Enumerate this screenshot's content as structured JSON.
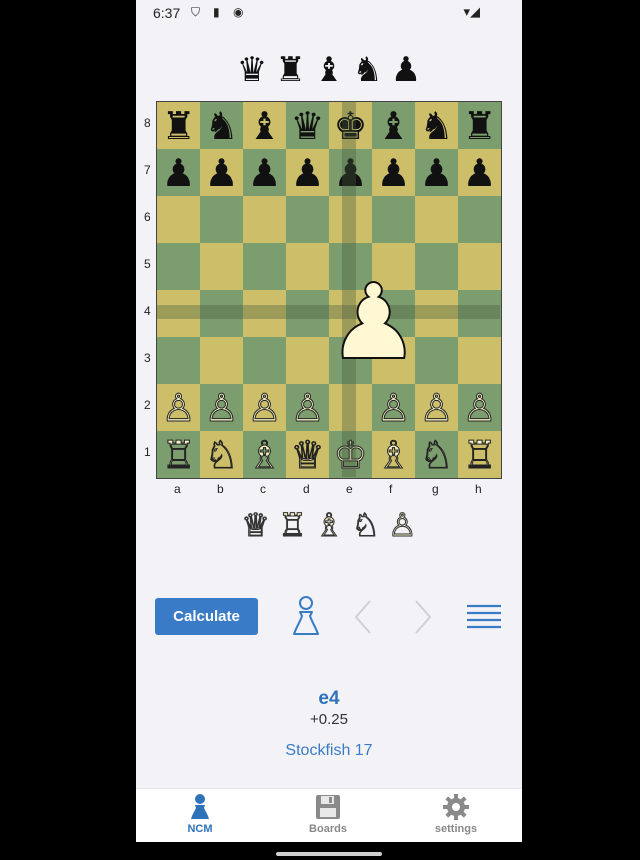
{
  "status_bar": {
    "time": "6:37"
  },
  "captured": {
    "black_pieces": [
      "♛",
      "♜",
      "♝",
      "♞",
      "♟"
    ],
    "white_pieces": [
      "♕",
      "♖",
      "♗",
      "♘",
      "♙"
    ]
  },
  "board": {
    "ranks": [
      "8",
      "7",
      "6",
      "5",
      "4",
      "3",
      "2",
      "1"
    ],
    "files": [
      "a",
      "b",
      "c",
      "d",
      "e",
      "f",
      "g",
      "h"
    ],
    "position": [
      [
        "b:♜",
        "b:♞",
        "b:♝",
        "b:♛",
        "b:♚",
        "b:♝",
        "b:♞",
        "b:♜"
      ],
      [
        "b:♟",
        "b:♟",
        "b:♟",
        "b:♟",
        "b:♟",
        "b:♟",
        "b:♟",
        "b:♟"
      ],
      [
        "",
        "",
        "",
        "",
        "",
        "",
        "",
        ""
      ],
      [
        "",
        "",
        "",
        "",
        "",
        "",
        "",
        ""
      ],
      [
        "",
        "",
        "",
        "",
        "",
        "",
        "",
        ""
      ],
      [
        "",
        "",
        "",
        "",
        "",
        "",
        "",
        ""
      ],
      [
        "w:♙",
        "w:♙",
        "w:♙",
        "w:♙",
        "",
        "w:♙",
        "w:♙",
        "w:♙"
      ],
      [
        "w:♖",
        "w:♘",
        "w:♗",
        "w:♕",
        "w:♔",
        "w:♗",
        "w:♘",
        "w:♖"
      ]
    ],
    "highlighted_piece": "♟",
    "colors": {
      "light": "#cdbf6a",
      "dark": "#7c9d6e"
    }
  },
  "controls": {
    "calculate_label": "Calculate",
    "pawn_icon": "pawn-icon",
    "prev_icon": "chevron-left-icon",
    "next_icon": "chevron-right-icon",
    "menu_icon": "menu-icon"
  },
  "analysis": {
    "move": "e4",
    "evaluation": "+0.25",
    "engine": "Stockfish 17"
  },
  "nav": {
    "items": [
      {
        "label": "NCM",
        "icon": "pawn-icon",
        "active": true
      },
      {
        "label": "Boards",
        "icon": "floppy-disk-icon",
        "active": false
      },
      {
        "label": "settings",
        "icon": "gear-icon",
        "active": false
      }
    ],
    "accent": "#2e73b9"
  }
}
